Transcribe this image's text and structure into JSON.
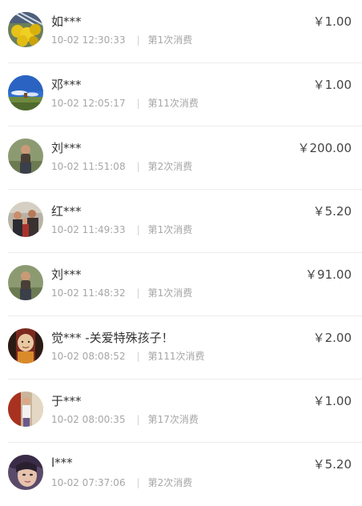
{
  "records": [
    {
      "name": "如***",
      "time": "10-02 12:30:33",
      "count": "第1次消费",
      "amount": "￥1.00",
      "avatar": "yellow-flowers-avatar"
    },
    {
      "name": "邓***",
      "time": "10-02 12:05:17",
      "count": "第11次消费",
      "amount": "￥1.00",
      "avatar": "blue-sky-landscape-avatar"
    },
    {
      "name": "刘***",
      "time": "10-02 11:51:08",
      "count": "第2次消费",
      "amount": "￥200.00",
      "avatar": "man-portrait-avatar"
    },
    {
      "name": "红***",
      "time": "10-02 11:49:33",
      "count": "第1次消费",
      "amount": "￥5.20",
      "avatar": "family-photo-avatar"
    },
    {
      "name": "刘***",
      "time": "10-02 11:48:32",
      "count": "第1次消费",
      "amount": "￥91.00",
      "avatar": "man-portrait-avatar"
    },
    {
      "name": "觉*** -关爱特殊孩子！",
      "time": "10-02 08:08:52",
      "count": "第111次消费",
      "amount": "￥2.00",
      "avatar": "buddha-figure-avatar"
    },
    {
      "name": "于***",
      "time": "10-02 08:00:35",
      "count": "第17次消费",
      "amount": "￥1.00",
      "avatar": "woman-standing-avatar"
    },
    {
      "name": "l***",
      "time": "10-02 07:37:06",
      "count": "第2次消费",
      "amount": "￥5.20",
      "avatar": "woman-closeup-avatar"
    }
  ],
  "separator": "|"
}
